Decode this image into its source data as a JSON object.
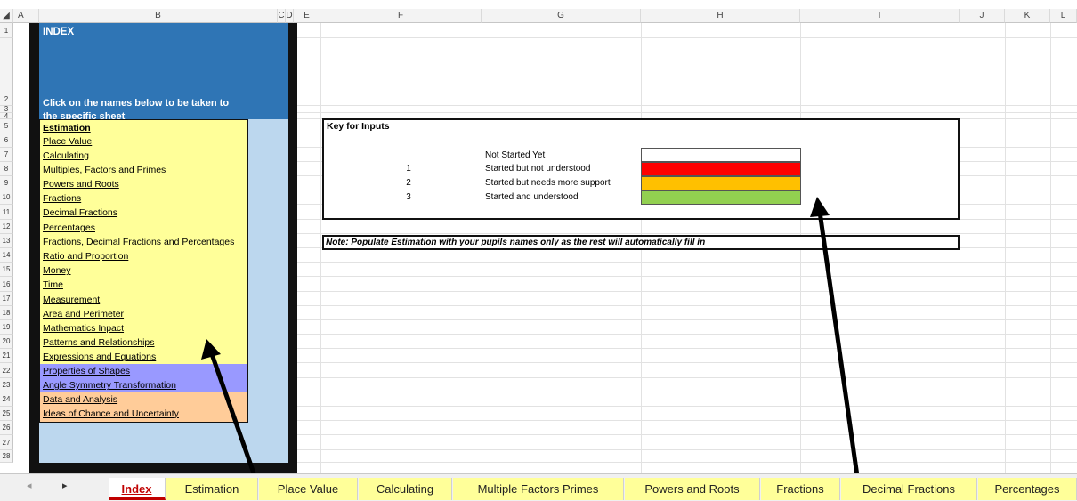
{
  "columns": {
    "a": "A",
    "b": "B",
    "c": "C",
    "d": "D",
    "e": "E",
    "f": "F",
    "g": "G",
    "h": "H",
    "i": "I",
    "j": "J",
    "k": "K",
    "l": "L"
  },
  "rows": [
    "1",
    "2",
    "3",
    "4",
    "5",
    "6",
    "7",
    "8",
    "9",
    "10",
    "11",
    "12",
    "13",
    "14",
    "15",
    "16",
    "17",
    "18",
    "19",
    "20",
    "21",
    "22",
    "23",
    "24",
    "25",
    "26",
    "27",
    "28"
  ],
  "index": {
    "title": "INDEX",
    "instruction_line1": "Click on the names below to be taken to",
    "instruction_line2": "the specific sheet",
    "items": [
      "Estimation",
      "Place Value",
      "Calculating",
      "Multiples, Factors and Primes",
      "Powers and Roots",
      "Fractions",
      "Decimal Fractions",
      "Percentages",
      "Fractions, Decimal Fractions and Percentages",
      "Ratio and Proportion",
      "Money",
      "Time",
      "Measurement",
      "Area and Perimeter",
      "Mathematics Inpact",
      "Patterns and Relationships",
      "Expressions and Equations",
      "Properties of Shapes",
      "Angle Symmetry Transformation",
      "Data and Analysis",
      "Ideas of Chance and Uncertainty"
    ]
  },
  "key": {
    "title": "Key for Inputs",
    "rows": [
      {
        "num": "",
        "label": "Not Started Yet",
        "color": "#ffffff"
      },
      {
        "num": "1",
        "label": "Started but not understood",
        "color": "#ff0000"
      },
      {
        "num": "2",
        "label": "Started but needs more support",
        "color": "#ffc000"
      },
      {
        "num": "3",
        "label": "Started and understood",
        "color": "#92d050"
      }
    ]
  },
  "note": "Note: Populate Estimation with your pupils names only as the rest will automatically fill in",
  "colors": {
    "yellow": "#ffff99",
    "violet": "#9999ff",
    "peach": "#ffcc99",
    "header_blue": "#2f75b5",
    "light_blue": "#bcd7ee"
  },
  "tabs": [
    "Index",
    "Estimation",
    "Place Value",
    "Calculating",
    "Multiple Factors Primes",
    "Powers and Roots",
    "Fractions",
    "Decimal Fractions",
    "Percentages"
  ],
  "nav": {
    "prev": "◂",
    "next": "▸"
  }
}
